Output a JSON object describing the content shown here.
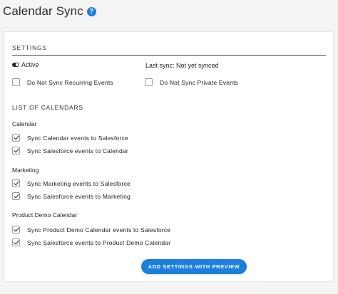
{
  "header": {
    "title": "Calendar Sync",
    "help_icon": "?"
  },
  "settings": {
    "section_title": "SETTINGS",
    "active_label": "Active",
    "last_sync": "Last sync: Not yet synced",
    "options": [
      {
        "label": "Do Not Sync Recurring Events",
        "checked": false
      },
      {
        "label": "Do Not Sync Private Events",
        "checked": false
      }
    ]
  },
  "calendars": {
    "section_title": "LIST OF CALENDARS",
    "groups": [
      {
        "name": "Calendar",
        "options": [
          {
            "label": "Sync Calendar events to Salesforce",
            "checked": true
          },
          {
            "label": "Sync Salesforce events to Calendar",
            "checked": true
          }
        ]
      },
      {
        "name": "Marketing",
        "options": [
          {
            "label": "Sync Marketing events to Salesforce",
            "checked": true
          },
          {
            "label": "Sync Salesforce events to Marketing",
            "checked": true
          }
        ]
      },
      {
        "name": "Product Demo Calendar",
        "options": [
          {
            "label": "Sync Product Demo Calendar events to Salesforce",
            "checked": true
          },
          {
            "label": "Sync Salesforce events to Product Demo Calendar",
            "checked": true
          }
        ]
      }
    ]
  },
  "actions": {
    "primary_label": "ADD SETTINGS WITH PREVIEW"
  },
  "colors": {
    "accent": "#1b7fe0",
    "background": "#f4f4f5",
    "card": "#ffffff"
  }
}
